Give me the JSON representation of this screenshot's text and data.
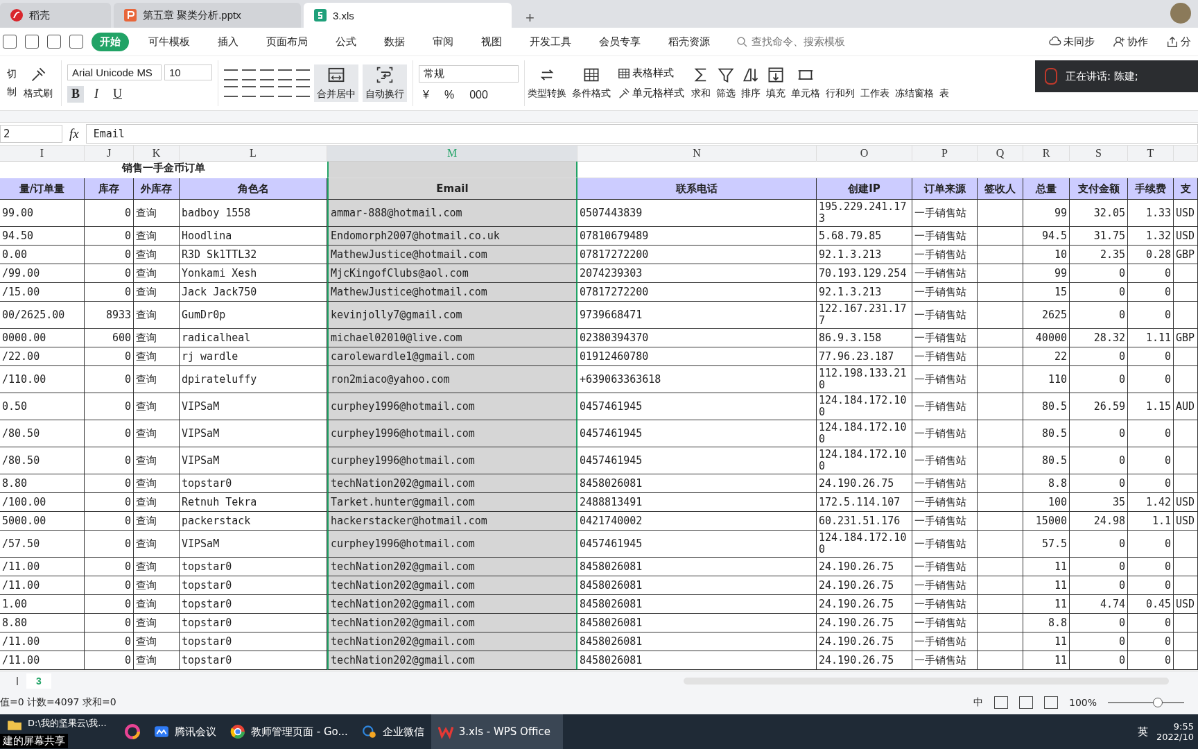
{
  "tabs": [
    {
      "label": "稻壳",
      "kind": "docer",
      "selected": false
    },
    {
      "label": "第五章 聚类分析.pptx",
      "kind": "ppt",
      "selected": false
    },
    {
      "label": "3.xls",
      "kind": "sheet",
      "selected": true
    }
  ],
  "new_tab": "+",
  "menu": {
    "tabs": [
      {
        "label": "开始",
        "selected": true
      },
      {
        "label": "可牛模板",
        "selected": false
      },
      {
        "label": "插入",
        "selected": false
      },
      {
        "label": "页面布局",
        "selected": false
      },
      {
        "label": "公式",
        "selected": false
      },
      {
        "label": "数据",
        "selected": false
      },
      {
        "label": "审阅",
        "selected": false
      },
      {
        "label": "视图",
        "selected": false
      },
      {
        "label": "开发工具",
        "selected": false
      },
      {
        "label": "会员专享",
        "selected": false
      },
      {
        "label": "稻壳资源",
        "selected": false
      }
    ],
    "search": {
      "placeholder": "查找命令、搜索模板"
    },
    "actions": [
      {
        "label": "未同步",
        "kind": "cloud"
      },
      {
        "label": "协作",
        "kind": "person"
      },
      {
        "label": "分",
        "kind": "share"
      }
    ]
  },
  "ribbon": {
    "clipboard": [
      "切",
      "制"
    ],
    "format_painter": "格式刷",
    "font": {
      "family": "Arial Unicode MS",
      "size": "10"
    },
    "font_styles": [
      {
        "label": "B",
        "on": true
      },
      {
        "label": "I",
        "on": false
      },
      {
        "label": "U",
        "on": false
      }
    ],
    "merge_buttons": [
      {
        "label": "合并居中",
        "kind": "merge"
      },
      {
        "label": "自动换行",
        "kind": "wrap"
      }
    ],
    "number_format": "常规",
    "number_symbols": [
      "¥",
      "%",
      "000"
    ],
    "tools": [
      {
        "kind": "convert",
        "label": "类型转换"
      },
      {
        "kind": "grid",
        "label": "条件格式"
      },
      {
        "kind": "stack",
        "items": [
          {
            "kind": "grid",
            "label": "表格样式"
          },
          {
            "kind": "brush",
            "label": "单元格样式"
          }
        ]
      },
      {
        "kind": "sigma",
        "label": "求和"
      },
      {
        "kind": "funnel",
        "label": "筛选"
      },
      {
        "kind": "sort",
        "label": "排序"
      },
      {
        "kind": "fill",
        "label": "填充"
      },
      {
        "kind": "cell",
        "label": "单元格"
      },
      {
        "kind": "covered",
        "label": "行和列"
      },
      {
        "kind": "covered",
        "label": "工作表"
      },
      {
        "kind": "covered",
        "label": "冻结窗格"
      },
      {
        "kind": "covered",
        "label": "表"
      }
    ]
  },
  "toast": "正在讲话: 陈建;",
  "formula_bar": {
    "name_box": "2",
    "fx": "fx",
    "formula": "Email"
  },
  "sheet": {
    "column_letters": [
      {
        "label": "I",
        "selected": false
      },
      {
        "label": "J",
        "selected": false
      },
      {
        "label": "K",
        "selected": false
      },
      {
        "label": "L",
        "selected": false
      },
      {
        "label": "M",
        "selected": true
      },
      {
        "label": "N",
        "selected": false
      },
      {
        "label": "O",
        "selected": false
      },
      {
        "label": "P",
        "selected": false
      },
      {
        "label": "Q",
        "selected": false
      },
      {
        "label": "R",
        "selected": false
      },
      {
        "label": "S",
        "selected": false
      },
      {
        "label": "T",
        "selected": false
      }
    ],
    "title": "销售一手金币订单",
    "headers": [
      "量/订单量",
      "库存",
      "外库存",
      "角色名",
      "Email",
      "联系电话",
      "创建IP",
      "订单来源",
      "签收人",
      "总量",
      "支付金额",
      "手续费",
      "支"
    ],
    "rows": [
      {
        "qty": "99.00",
        "stock": "0",
        "ext": "查询",
        "role": "badboy 1558",
        "email": "ammar-888@hotmail.com",
        "phone": "0507443839",
        "ip": "195.229.241.173",
        "source": "一手销售站",
        "total": "99",
        "paid": "32.05",
        "fee": "1.33",
        "currency": "USD"
      },
      {
        "qty": "94.50",
        "stock": "0",
        "ext": "查询",
        "role": "Hoodlina",
        "email": "Endomorph2007@hotmail.co.uk",
        "phone": "07810679489",
        "ip": "5.68.79.85",
        "source": "一手销售站",
        "total": "94.5",
        "paid": "31.75",
        "fee": "1.32",
        "currency": "USD"
      },
      {
        "qty": "0.00",
        "stock": "0",
        "ext": "查询",
        "role": "R3D Sk1TTL32",
        "email": "MathewJustice@hotmail.com",
        "phone": "07817272200",
        "ip": "92.1.3.213",
        "source": "一手销售站",
        "total": "10",
        "paid": "2.35",
        "fee": "0.28",
        "currency": "GBP"
      },
      {
        "qty": "/99.00",
        "stock": "0",
        "ext": "查询",
        "role": "Yonkami Xesh",
        "email": "MjcKingofClubs@aol.com",
        "phone": "2074239303",
        "ip": "70.193.129.254",
        "source": "一手销售站",
        "total": "99",
        "paid": "0",
        "fee": "0"
      },
      {
        "qty": "/15.00",
        "stock": "0",
        "ext": "查询",
        "role": "Jack Jack750",
        "email": "MathewJustice@hotmail.com",
        "phone": "07817272200",
        "ip": "92.1.3.213",
        "source": "一手销售站",
        "total": "15",
        "paid": "0",
        "fee": "0"
      },
      {
        "qty": "00/2625.00",
        "stock": "8933",
        "ext": "查询",
        "role": "GumDr0p",
        "email": "kevinjolly7@gmail.com",
        "phone": "9739668471",
        "ip": "122.167.231.177",
        "source": "一手销售站",
        "total": "2625",
        "paid": "0",
        "fee": "0"
      },
      {
        "qty": "0000.00",
        "stock": "600",
        "ext": "查询",
        "role": "radicalheal",
        "email": "michael02010@live.com",
        "phone": "02380394370",
        "ip": "86.9.3.158",
        "source": "一手销售站",
        "total": "40000",
        "paid": "28.32",
        "fee": "1.11",
        "currency": "GBP"
      },
      {
        "qty": "/22.00",
        "stock": "0",
        "ext": "查询",
        "role": "rj wardle",
        "email": "carolewardle1@gmail.com",
        "phone": "01912460780",
        "ip": "77.96.23.187",
        "source": "一手销售站",
        "total": "22",
        "paid": "0",
        "fee": "0"
      },
      {
        "qty": "/110.00",
        "stock": "0",
        "ext": "查询",
        "role": "dpirateluffy",
        "email": "ron2miaco@yahoo.com",
        "phone": "+639063363618",
        "ip": "112.198.133.210",
        "source": "一手销售站",
        "total": "110",
        "paid": "0",
        "fee": "0"
      },
      {
        "qty": "0.50",
        "stock": "0",
        "ext": "查询",
        "role": "VIPSaM",
        "email": "curphey1996@hotmail.com",
        "phone": "0457461945",
        "ip": "124.184.172.100",
        "source": "一手销售站",
        "total": "80.5",
        "paid": "26.59",
        "fee": "1.15",
        "currency": "AUD"
      },
      {
        "qty": "/80.50",
        "stock": "0",
        "ext": "查询",
        "role": "VIPSaM",
        "email": "curphey1996@hotmail.com",
        "phone": "0457461945",
        "ip": "124.184.172.100",
        "source": "一手销售站",
        "total": "80.5",
        "paid": "0",
        "fee": "0"
      },
      {
        "qty": "/80.50",
        "stock": "0",
        "ext": "查询",
        "role": "VIPSaM",
        "email": "curphey1996@hotmail.com",
        "phone": "0457461945",
        "ip": "124.184.172.100",
        "source": "一手销售站",
        "total": "80.5",
        "paid": "0",
        "fee": "0"
      },
      {
        "qty": "8.80",
        "stock": "0",
        "ext": "查询",
        "role": "topstar0",
        "email": "techNation202@gmail.com",
        "phone": "8458026081",
        "ip": "24.190.26.75",
        "source": "一手销售站",
        "total": "8.8",
        "paid": "0",
        "fee": "0"
      },
      {
        "qty": "/100.00",
        "stock": "0",
        "ext": "查询",
        "role": "Retnuh Tekra",
        "email": "Tarket.hunter@gmail.com",
        "phone": "2488813491",
        "ip": "172.5.114.107",
        "source": "一手销售站",
        "total": "100",
        "paid": "35",
        "fee": "1.42",
        "currency": "USD"
      },
      {
        "qty": "5000.00",
        "stock": "0",
        "ext": "查询",
        "role": "packerstack",
        "email": "hackerstacker@hotmail.com",
        "phone": "0421740002",
        "ip": "60.231.51.176",
        "source": "一手销售站",
        "total": "15000",
        "paid": "24.98",
        "fee": "1.1",
        "currency": "USD"
      },
      {
        "qty": "/57.50",
        "stock": "0",
        "ext": "查询",
        "role": "VIPSaM",
        "email": "curphey1996@hotmail.com",
        "phone": "0457461945",
        "ip": "124.184.172.100",
        "source": "一手销售站",
        "total": "57.5",
        "paid": "0",
        "fee": "0"
      },
      {
        "qty": "/11.00",
        "stock": "0",
        "ext": "查询",
        "role": "topstar0",
        "email": "techNation202@gmail.com",
        "phone": "8458026081",
        "ip": "24.190.26.75",
        "source": "一手销售站",
        "total": "11",
        "paid": "0",
        "fee": "0"
      },
      {
        "qty": "/11.00",
        "stock": "0",
        "ext": "查询",
        "role": "topstar0",
        "email": "techNation202@gmail.com",
        "phone": "8458026081",
        "ip": "24.190.26.75",
        "source": "一手销售站",
        "total": "11",
        "paid": "0",
        "fee": "0"
      },
      {
        "qty": "1.00",
        "stock": "0",
        "ext": "查询",
        "role": "topstar0",
        "email": "techNation202@gmail.com",
        "phone": "8458026081",
        "ip": "24.190.26.75",
        "source": "一手销售站",
        "total": "11",
        "paid": "4.74",
        "fee": "0.45",
        "currency": "USD"
      },
      {
        "qty": "8.80",
        "stock": "0",
        "ext": "查询",
        "role": "topstar0",
        "email": "techNation202@gmail.com",
        "phone": "8458026081",
        "ip": "24.190.26.75",
        "source": "一手销售站",
        "total": "8.8",
        "paid": "0",
        "fee": "0"
      },
      {
        "qty": "/11.00",
        "stock": "0",
        "ext": "查询",
        "role": "topstar0",
        "email": "techNation202@gmail.com",
        "phone": "8458026081",
        "ip": "24.190.26.75",
        "source": "一手销售站",
        "total": "11",
        "paid": "0",
        "fee": "0"
      },
      {
        "qty": "/11.00",
        "stock": "0",
        "ext": "查询",
        "role": "topstar0",
        "email": "techNation202@gmail.com",
        "phone": "8458026081",
        "ip": "24.190.26.75",
        "source": "一手销售站",
        "total": "11",
        "paid": "0",
        "fee": "0"
      }
    ]
  },
  "sheet_tabs": [
    {
      "label": "3",
      "selected": true
    }
  ],
  "status_bar": {
    "stats": "值=0 计数=4097 求和=0",
    "input_mode": "中",
    "zoom": "100%",
    "zoom_slider": {
      "level": 0.65
    }
  },
  "taskbar": {
    "items": [
      {
        "kind": "folder",
        "label": "D:\\我的坚果云\\我...",
        "active": false
      },
      {
        "kind": "ring",
        "active": false
      },
      {
        "kind": "meeting",
        "label": "腾讯会议",
        "active": false
      },
      {
        "kind": "browser",
        "label": "教师管理页面 - Go...",
        "active": false
      },
      {
        "kind": "chat",
        "label": "企业微信",
        "active": false
      },
      {
        "kind": "wps",
        "label": "3.xls - WPS Office",
        "active": true
      }
    ],
    "share_label": "建的屏幕共享",
    "ime": "英",
    "time": "9:55",
    "date": "2022/10"
  }
}
